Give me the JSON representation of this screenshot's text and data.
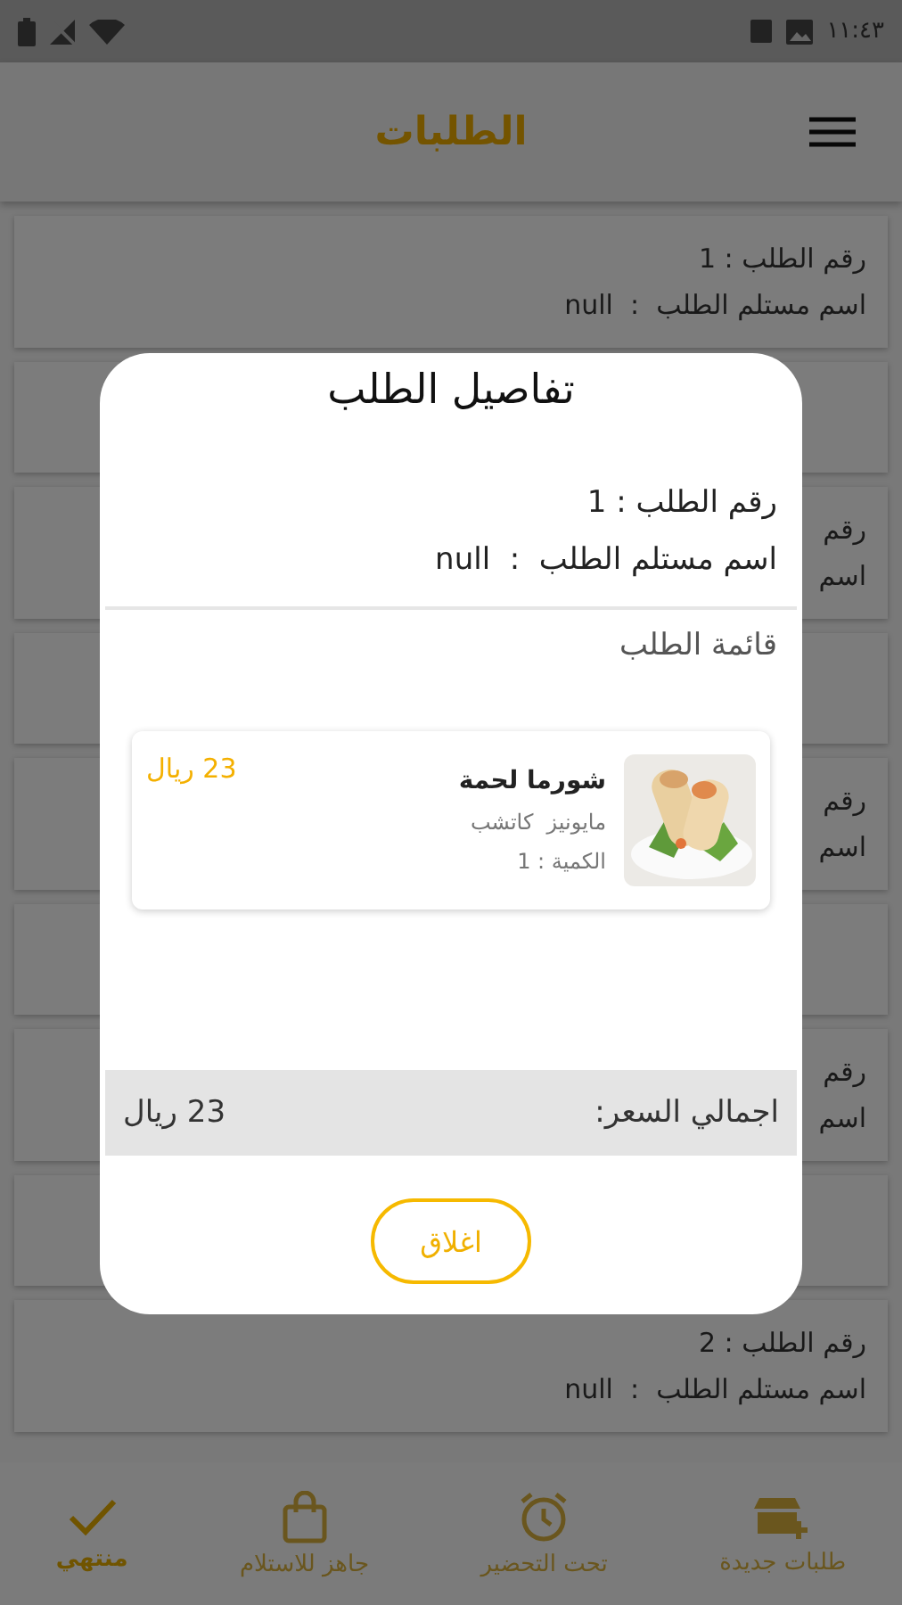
{
  "status_bar": {
    "time": "١١:٤٣"
  },
  "app_bar": {
    "title": "الطلبات"
  },
  "orders": [
    {
      "kind": "order",
      "number": "رقم الطلب : 1",
      "receiver": "اسم مستلم الطلب  :  null"
    },
    {
      "kind": "blank"
    },
    {
      "kind": "order",
      "number": "رقم",
      "receiver": "اسم"
    },
    {
      "kind": "blank"
    },
    {
      "kind": "order",
      "number": "رقم",
      "receiver": "اسم"
    },
    {
      "kind": "blank"
    },
    {
      "kind": "order",
      "number": "رقم",
      "receiver": "اسم"
    },
    {
      "kind": "blank"
    },
    {
      "kind": "order",
      "number": "رقم الطلب : 2",
      "receiver": "اسم مستلم الطلب  :  null"
    }
  ],
  "bottom_nav": [
    {
      "label": "طلبات جديدة",
      "selected": false
    },
    {
      "label": "تحت التحضير",
      "selected": false
    },
    {
      "label": "جاهز للاستلام",
      "selected": false
    },
    {
      "label": "منتهي",
      "selected": true
    }
  ],
  "dialog": {
    "title": "تفاصيل الطلب",
    "number": "رقم الطلب : 1",
    "receiver": "اسم مستلم الطلب  :  null",
    "list_title": "قائمة الطلب",
    "items": [
      {
        "kind": "picture",
        "name": "شورما لحمة",
        "extras": "مايونيز  كاتشب",
        "quantity": "الكمية : 1",
        "price": "23 ريال"
      }
    ],
    "total_label": "اجمالي السعر:",
    "total_value": "23 ريال",
    "close": "اغلاق"
  }
}
